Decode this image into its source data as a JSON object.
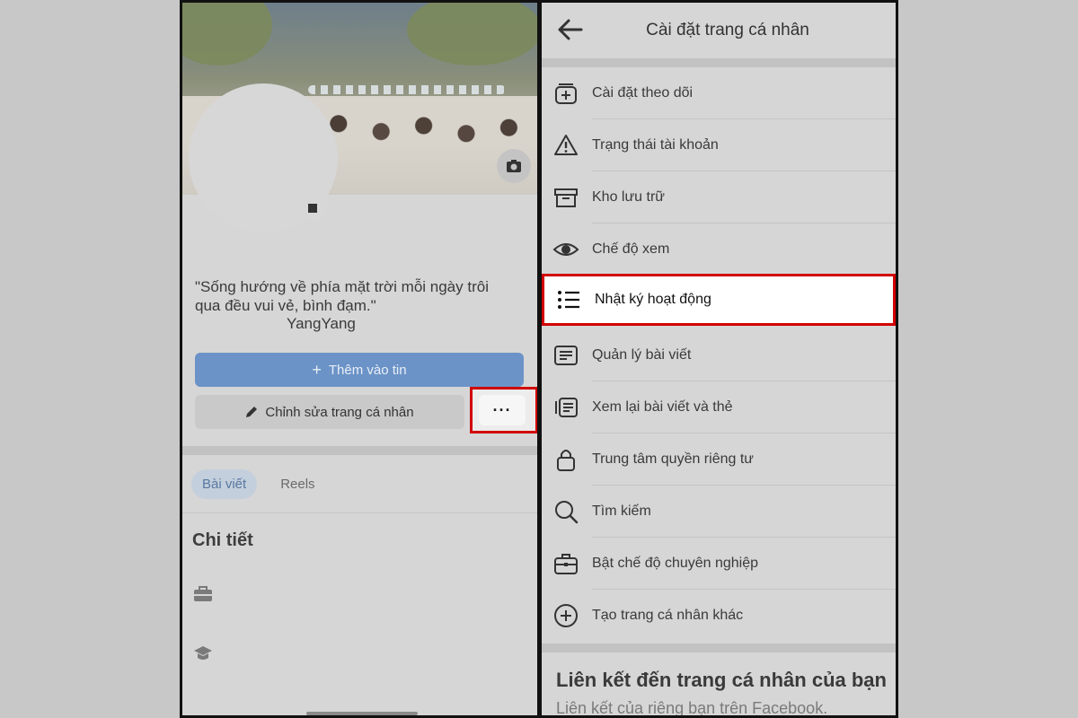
{
  "left_phone": {
    "bio_quote": "\"Sống hướng về phía mặt trời mỗi ngày trôi qua đều vui vẻ, bình đạm.\"",
    "bio_author": "YangYang",
    "add_story_label": "Thêm vào tin",
    "edit_profile_label": "Chỉnh sửa trang cá nhân",
    "more_label": "···",
    "tabs": [
      {
        "label": "Bài viết",
        "active": true
      },
      {
        "label": "Reels",
        "active": false
      }
    ],
    "details_title": "Chi tiết",
    "icons": [
      "camera-icon",
      "plus-icon",
      "pencil-icon",
      "briefcase-icon",
      "graduation-cap-icon"
    ]
  },
  "right_phone": {
    "title": "Cài đặt trang cá nhân",
    "menu": [
      {
        "label": "Cài đặt theo dõi",
        "icon": "follow-settings-icon"
      },
      {
        "label": "Trạng thái tài khoản",
        "icon": "warning-icon"
      },
      {
        "label": "Kho lưu trữ",
        "icon": "archive-icon"
      },
      {
        "label": "Chế độ xem",
        "icon": "eye-icon"
      },
      {
        "label": "Nhật ký hoạt động",
        "icon": "list-icon",
        "highlighted": true
      },
      {
        "label": "Quản lý bài viết",
        "icon": "posts-icon"
      },
      {
        "label": "Xem lại bài viết và thẻ",
        "icon": "review-tags-icon"
      },
      {
        "label": "Trung tâm quyền riêng tư",
        "icon": "lock-icon"
      },
      {
        "label": "Tìm kiếm",
        "icon": "search-icon"
      },
      {
        "label": "Bật chế độ chuyên nghiệp",
        "icon": "briefcase-icon"
      },
      {
        "label": "Tạo trang cá nhân khác",
        "icon": "plus-circle-icon"
      }
    ],
    "link_section_title": "Liên kết đến trang cá nhân của bạn",
    "link_section_subtitle": "Liên kết của riêng bạn trên Facebook."
  },
  "colors": {
    "highlight_border": "#d10000",
    "primary_button": "#6b93c7"
  }
}
